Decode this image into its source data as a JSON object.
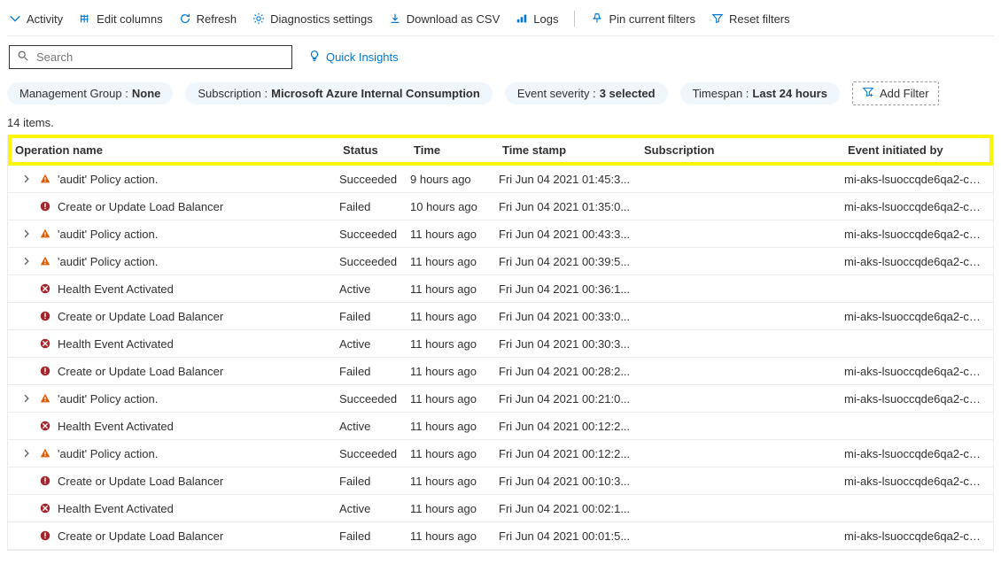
{
  "toolbar": {
    "activity": "Activity",
    "edit_columns": "Edit columns",
    "refresh": "Refresh",
    "diagnostics": "Diagnostics settings",
    "download": "Download as CSV",
    "logs": "Logs",
    "pin_filters": "Pin current filters",
    "reset_filters": "Reset filters"
  },
  "search": {
    "placeholder": "Search"
  },
  "quick_insights": "Quick Insights",
  "filters": {
    "f0": {
      "label": "Management Group : ",
      "value": "None"
    },
    "f1": {
      "label": "Subscription : ",
      "value": "Microsoft Azure Internal Consumption"
    },
    "f2": {
      "label": "Event severity : ",
      "value": "3 selected"
    },
    "f3": {
      "label": "Timespan : ",
      "value": "Last 24 hours"
    },
    "add": "Add Filter"
  },
  "count": "14 items.",
  "columns": {
    "op": "Operation name",
    "status": "Status",
    "time": "Time",
    "ts": "Time stamp",
    "sub": "Subscription",
    "init": "Event initiated by"
  },
  "rows": [
    {
      "expand": true,
      "icon": "warn",
      "op": "'audit' Policy action.",
      "status": "Succeeded",
      "time": "9 hours ago",
      "ts": "Fri Jun 04 2021 01:45:3...",
      "sub": "",
      "init": "mi-aks-lsuoccqde6qa2-co..."
    },
    {
      "expand": false,
      "icon": "error",
      "op": "Create or Update Load Balancer",
      "status": "Failed",
      "time": "10 hours ago",
      "ts": "Fri Jun 04 2021 01:35:0...",
      "sub": "",
      "init": "mi-aks-lsuoccqde6qa2-co..."
    },
    {
      "expand": true,
      "icon": "warn",
      "op": "'audit' Policy action.",
      "status": "Succeeded",
      "time": "11 hours ago",
      "ts": "Fri Jun 04 2021 00:43:3...",
      "sub": "",
      "init": "mi-aks-lsuoccqde6qa2-co..."
    },
    {
      "expand": true,
      "icon": "warn",
      "op": "'audit' Policy action.",
      "status": "Succeeded",
      "time": "11 hours ago",
      "ts": "Fri Jun 04 2021 00:39:5...",
      "sub": "",
      "init": "mi-aks-lsuoccqde6qa2-co..."
    },
    {
      "expand": false,
      "icon": "errorx",
      "op": "Health Event Activated",
      "status": "Active",
      "time": "11 hours ago",
      "ts": "Fri Jun 04 2021 00:36:1...",
      "sub": "",
      "init": ""
    },
    {
      "expand": false,
      "icon": "error",
      "op": "Create or Update Load Balancer",
      "status": "Failed",
      "time": "11 hours ago",
      "ts": "Fri Jun 04 2021 00:33:0...",
      "sub": "",
      "init": "mi-aks-lsuoccqde6qa2-co..."
    },
    {
      "expand": false,
      "icon": "errorx",
      "op": "Health Event Activated",
      "status": "Active",
      "time": "11 hours ago",
      "ts": "Fri Jun 04 2021 00:30:3...",
      "sub": "",
      "init": ""
    },
    {
      "expand": false,
      "icon": "error",
      "op": "Create or Update Load Balancer",
      "status": "Failed",
      "time": "11 hours ago",
      "ts": "Fri Jun 04 2021 00:28:2...",
      "sub": "",
      "init": "mi-aks-lsuoccqde6qa2-co..."
    },
    {
      "expand": true,
      "icon": "warn",
      "op": "'audit' Policy action.",
      "status": "Succeeded",
      "time": "11 hours ago",
      "ts": "Fri Jun 04 2021 00:21:0...",
      "sub": "",
      "init": "mi-aks-lsuoccqde6qa2-co..."
    },
    {
      "expand": false,
      "icon": "errorx",
      "op": "Health Event Activated",
      "status": "Active",
      "time": "11 hours ago",
      "ts": "Fri Jun 04 2021 00:12:2...",
      "sub": "",
      "init": ""
    },
    {
      "expand": true,
      "icon": "warn",
      "op": "'audit' Policy action.",
      "status": "Succeeded",
      "time": "11 hours ago",
      "ts": "Fri Jun 04 2021 00:12:2...",
      "sub": "",
      "init": "mi-aks-lsuoccqde6qa2-co..."
    },
    {
      "expand": false,
      "icon": "error",
      "op": "Create or Update Load Balancer",
      "status": "Failed",
      "time": "11 hours ago",
      "ts": "Fri Jun 04 2021 00:10:3...",
      "sub": "",
      "init": "mi-aks-lsuoccqde6qa2-co..."
    },
    {
      "expand": false,
      "icon": "errorx",
      "op": "Health Event Activated",
      "status": "Active",
      "time": "11 hours ago",
      "ts": "Fri Jun 04 2021 00:02:1...",
      "sub": "",
      "init": ""
    },
    {
      "expand": false,
      "icon": "error",
      "op": "Create or Update Load Balancer",
      "status": "Failed",
      "time": "11 hours ago",
      "ts": "Fri Jun 04 2021 00:01:5...",
      "sub": "",
      "init": "mi-aks-lsuoccqde6qa2-co..."
    }
  ]
}
